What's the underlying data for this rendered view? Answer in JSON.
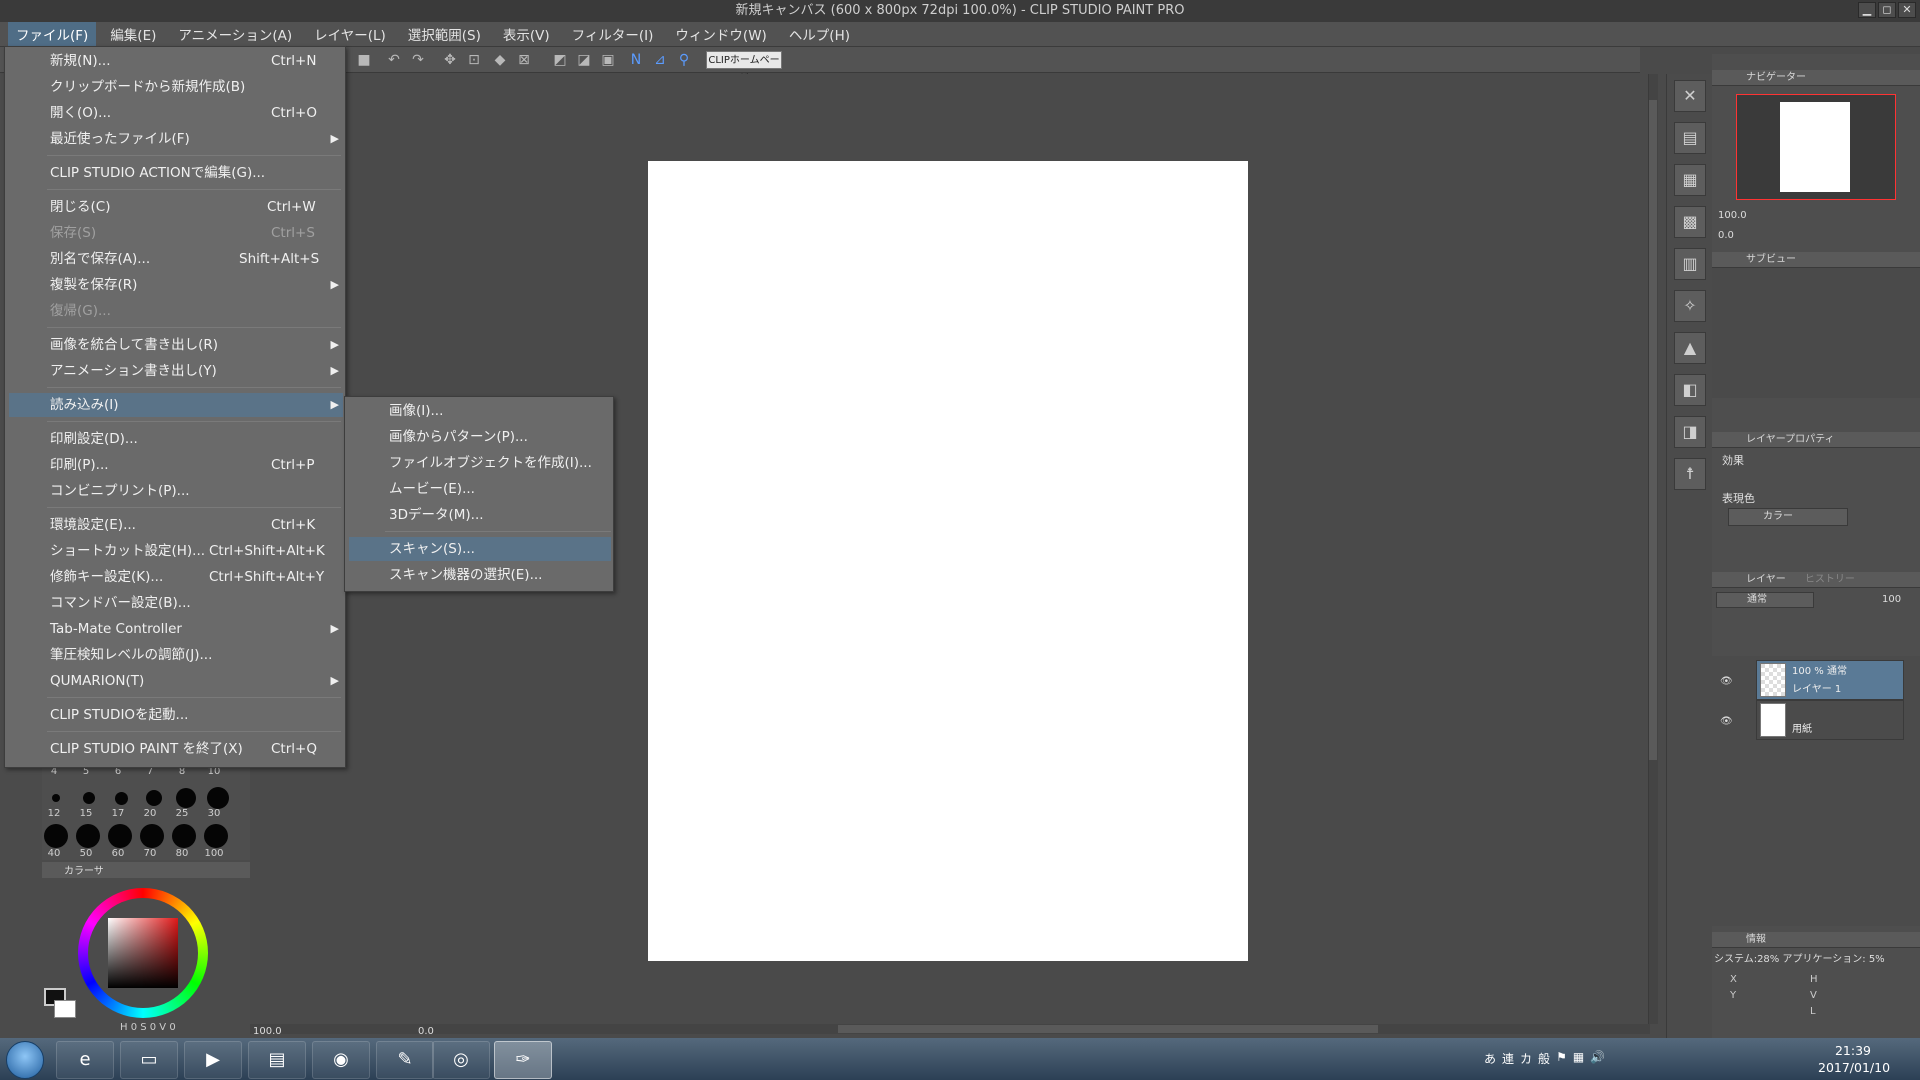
{
  "window": {
    "title": "新規キャンバス (600 x 800px 72dpi 100.0%) - CLIP STUDIO PAINT PRO",
    "controls": [
      "▁",
      "◻",
      "✕"
    ]
  },
  "menubar": [
    "ファイル(F)",
    "編集(E)",
    "アニメーション(A)",
    "レイヤー(L)",
    "選択範囲(S)",
    "表示(V)",
    "フィルター(I)",
    "ウィンドウ(W)",
    "ヘルプ(H)"
  ],
  "commandbar": {
    "home_label": "CLIPホームページ"
  },
  "file_menu": {
    "new": {
      "label": "新規(N)...",
      "shortcut": "Ctrl+N"
    },
    "new_clipboard": {
      "label": "クリップボードから新規作成(B)"
    },
    "open": {
      "label": "開く(O)...",
      "shortcut": "Ctrl+O"
    },
    "recent": {
      "label": "最近使ったファイル(F)"
    },
    "action_edit": {
      "label": "CLIP STUDIO ACTIONで編集(G)..."
    },
    "close": {
      "label": "閉じる(C)",
      "shortcut": "Ctrl+W"
    },
    "save": {
      "label": "保存(S)",
      "shortcut": "Ctrl+S"
    },
    "save_as": {
      "label": "別名で保存(A)...",
      "shortcut": "Shift+Alt+S"
    },
    "save_copy": {
      "label": "複製を保存(R)"
    },
    "revert": {
      "label": "復帰(G)..."
    },
    "export_merged": {
      "label": "画像を統合して書き出し(R)"
    },
    "export_anim": {
      "label": "アニメーション書き出し(Y)"
    },
    "import": {
      "label": "読み込み(I)"
    },
    "print_settings": {
      "label": "印刷設定(D)..."
    },
    "print": {
      "label": "印刷(P)...",
      "shortcut": "Ctrl+P"
    },
    "conveni_print": {
      "label": "コンビニプリント(P)..."
    },
    "preferences": {
      "label": "環境設定(E)...",
      "shortcut": "Ctrl+K"
    },
    "shortcut_settings": {
      "label": "ショートカット設定(H)...",
      "shortcut": "Ctrl+Shift+Alt+K"
    },
    "modifier_settings": {
      "label": "修飾キー設定(K)...",
      "shortcut": "Ctrl+Shift+Alt+Y"
    },
    "commandbar_settings": {
      "label": "コマンドバー設定(B)..."
    },
    "tabmate": {
      "label": "Tab-Mate Controller"
    },
    "pressure": {
      "label": "筆圧検知レベルの調節(J)..."
    },
    "quamarion": {
      "label": "QUMARION(T)"
    },
    "launch_studio": {
      "label": "CLIP STUDIOを起動..."
    },
    "exit": {
      "label": "CLIP STUDIO PAINT を終了(X)",
      "shortcut": "Ctrl+Q"
    }
  },
  "import_submenu": [
    "画像(I)...",
    "画像からパターン(P)...",
    "ファイルオブジェクトを作成(I)...",
    "ムービー(E)...",
    "3Dデータ(M)...",
    "スキャン(S)...",
    "スキャン機器の選択(E)..."
  ],
  "brush_size": {
    "top_row": [
      "4",
      "5",
      "6",
      "7",
      "8",
      "10"
    ],
    "mid_row": [
      "12",
      "15",
      "17",
      "20",
      "25",
      "30"
    ],
    "bottom_row": [
      "40",
      "50",
      "60",
      "70",
      "80",
      "100"
    ]
  },
  "color_panel": {
    "tab_label": "カラーサ",
    "hsv_readout": "H 0 S 0 V 0",
    "fg_color": "#111111",
    "bg_color": "#ffffff",
    "hue_color": "#e01818"
  },
  "navigator": {
    "title": "ナビゲーター",
    "zoom": "100.0",
    "angle": "0.0"
  },
  "subview": {
    "title": "サブビュー"
  },
  "layer_property": {
    "title": "レイヤープロパティ",
    "effect_label": "効果",
    "expression_label": "表現色",
    "expression_value": "カラー"
  },
  "layers_panel": {
    "tab_layer": "レイヤー",
    "tab_history": "ヒストリー",
    "blend_mode": "通常",
    "opacity": "100",
    "layers": [
      {
        "top": "100 % 通常",
        "name": "レイヤー 1"
      },
      {
        "top": "",
        "name": "用紙"
      }
    ]
  },
  "info_panel": {
    "title": "情報",
    "line": "システム:28%  アプリケーション: 5%",
    "labels": [
      "X",
      "Y",
      "H",
      "V",
      "L"
    ]
  },
  "statusbar": {
    "zoom": "100.0",
    "rotation": "0.0"
  },
  "taskbar": {
    "time": "21:39",
    "date": "2017/01/10",
    "ime": [
      "あ",
      "連",
      "カ",
      "般"
    ]
  }
}
